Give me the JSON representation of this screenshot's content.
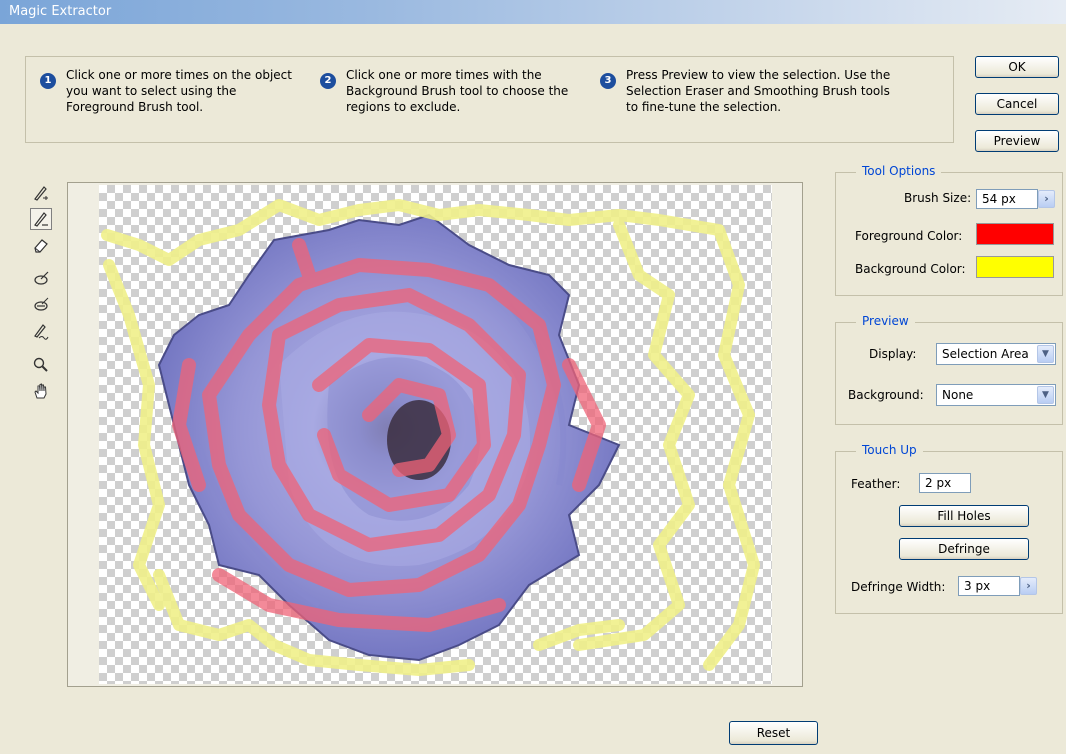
{
  "window": {
    "title": "Magic Extractor"
  },
  "steps": [
    {
      "num": "1",
      "text": "Click one or more times on the object you want to select using the Foreground Brush tool."
    },
    {
      "num": "2",
      "text": "Click one or more times with the Background Brush tool to choose the regions to exclude."
    },
    {
      "num": "3",
      "text": "Press Preview to view the selection. Use the Selection Eraser and Smoothing Brush tools to fine-tune the selection."
    }
  ],
  "buttons": {
    "ok": "OK",
    "cancel": "Cancel",
    "preview": "Preview",
    "reset": "Reset"
  },
  "tools": [
    {
      "name": "foreground-brush-icon",
      "active": false
    },
    {
      "name": "background-brush-icon",
      "active": true
    },
    {
      "name": "point-eraser-icon",
      "active": false
    },
    {
      "name": "add-to-selection-icon",
      "active": false
    },
    {
      "name": "remove-from-selection-icon",
      "active": false
    },
    {
      "name": "smoothing-brush-icon",
      "active": false
    },
    {
      "name": "zoom-icon",
      "active": false
    },
    {
      "name": "hand-icon",
      "active": false
    }
  ],
  "tool_options": {
    "title": "Tool Options",
    "brush_size_label": "Brush Size:",
    "brush_size_value": "54 px",
    "foreground_label": "Foreground Color:",
    "foreground_color": "#ff0000",
    "background_label": "Background Color:",
    "background_color": "#ffff00"
  },
  "preview": {
    "title": "Preview",
    "display_label": "Display:",
    "display_value": "Selection Area",
    "background_label": "Background:",
    "background_value": "None"
  },
  "touch_up": {
    "title": "Touch Up",
    "feather_label": "Feather:",
    "feather_value": "2 px",
    "fill_holes": "Fill Holes",
    "defringe": "Defringe",
    "defringe_width_label": "Defringe Width:",
    "defringe_width_value": "3 px"
  },
  "colors": {
    "accent": "#0046d5",
    "dialog_bg": "#ece9d8"
  }
}
